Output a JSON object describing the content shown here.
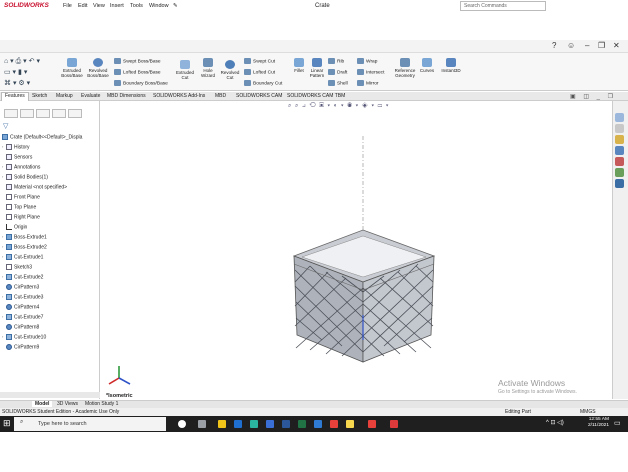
{
  "app": {
    "logo": "SOLIDWORKS",
    "menu": [
      "File",
      "Edit",
      "View",
      "Insert",
      "Tools",
      "Window"
    ],
    "document_title": "Crate",
    "search_placeholder": "Search Commands"
  },
  "ribbon": {
    "large_buttons": [
      {
        "label": "Extruded Boss/Base"
      },
      {
        "label": "Revolved Boss/Base"
      },
      {
        "label": "Extruded Cut"
      },
      {
        "label": "Hole Wizard"
      },
      {
        "label": "Revolved Cut"
      },
      {
        "label": "Fillet"
      },
      {
        "label": "Linear Pattern"
      },
      {
        "label": "Reference Geometry"
      },
      {
        "label": "Curves"
      },
      {
        "label": "Instant3D"
      }
    ],
    "small_buttons": {
      "swept_boss": "Swept Boss/Base",
      "lofted_boss": "Lofted Boss/Base",
      "boundary_boss": "Boundary Boss/Base",
      "swept_cut": "Swept Cut",
      "lofted_cut": "Lofted Cut",
      "boundary_cut": "Boundary Cut",
      "rib": "Rib",
      "draft": "Draft",
      "shell": "Shell",
      "wrap": "Wrap",
      "intersect": "Intersect",
      "mirror": "Mirror"
    }
  },
  "command_tabs": [
    "Features",
    "Sketch",
    "Markup",
    "Evaluate",
    "MBD Dimensions",
    "SOLIDWORKS Add-Ins",
    "MBD",
    "SOLIDWORKS CAM",
    "SOLIDWORKS CAM TBM"
  ],
  "feature_tree": {
    "root": "Crate  (Default<<Default>_Displa",
    "items": [
      {
        "label": "History",
        "icon": "history-icon"
      },
      {
        "label": "Sensors",
        "icon": "sensors-icon"
      },
      {
        "label": "Annotations",
        "icon": "annotations-icon"
      },
      {
        "label": "Solid Bodies(1)",
        "icon": "solid-bodies-icon"
      },
      {
        "label": "Material <not specified>",
        "icon": "material-icon"
      },
      {
        "label": "Front Plane",
        "icon": "plane-icon"
      },
      {
        "label": "Top Plane",
        "icon": "plane-icon"
      },
      {
        "label": "Right Plane",
        "icon": "plane-icon"
      },
      {
        "label": "Origin",
        "icon": "origin-icon"
      },
      {
        "label": "Boss-Extrude1",
        "icon": "extrude-icon"
      },
      {
        "label": "Boss-Extrude2",
        "icon": "extrude-icon"
      },
      {
        "label": "Cut-Extrude1",
        "icon": "cut-extrude-icon"
      },
      {
        "label": "Sketch3",
        "icon": "sketch-icon"
      },
      {
        "label": "Cut-Extrude2",
        "icon": "cut-extrude-icon"
      },
      {
        "label": "CirPattern3",
        "icon": "circular-pattern-icon"
      },
      {
        "label": "Cut-Extrude3",
        "icon": "cut-extrude-icon"
      },
      {
        "label": "CirPattern4",
        "icon": "circular-pattern-icon"
      },
      {
        "label": "Cut-Extrude7",
        "icon": "cut-extrude-icon"
      },
      {
        "label": "CirPattern8",
        "icon": "circular-pattern-icon"
      },
      {
        "label": "Cut-Extrude10",
        "icon": "cut-extrude-icon"
      },
      {
        "label": "CirPattern9",
        "icon": "circular-pattern-icon"
      }
    ]
  },
  "viewport": {
    "view_label": "*Isometric",
    "watermark_line1": "Activate Windows",
    "watermark_line2": "Go to Settings to activate Windows."
  },
  "bottom_tabs": [
    "Model",
    "3D Views",
    "Motion Study 1"
  ],
  "status_bar": {
    "left": "SOLIDWORKS Student Edition - Academic Use Only",
    "mode": "Editing Part",
    "units": "MMGS"
  },
  "taskbar": {
    "search_placeholder": "Type here to search",
    "time": "12:55 AM",
    "date": "2/11/2021"
  },
  "colors": {
    "brand_red": "#c8102e",
    "ribbon_blue": "#3b6ea5",
    "model_gray": "#b8bcc4"
  }
}
